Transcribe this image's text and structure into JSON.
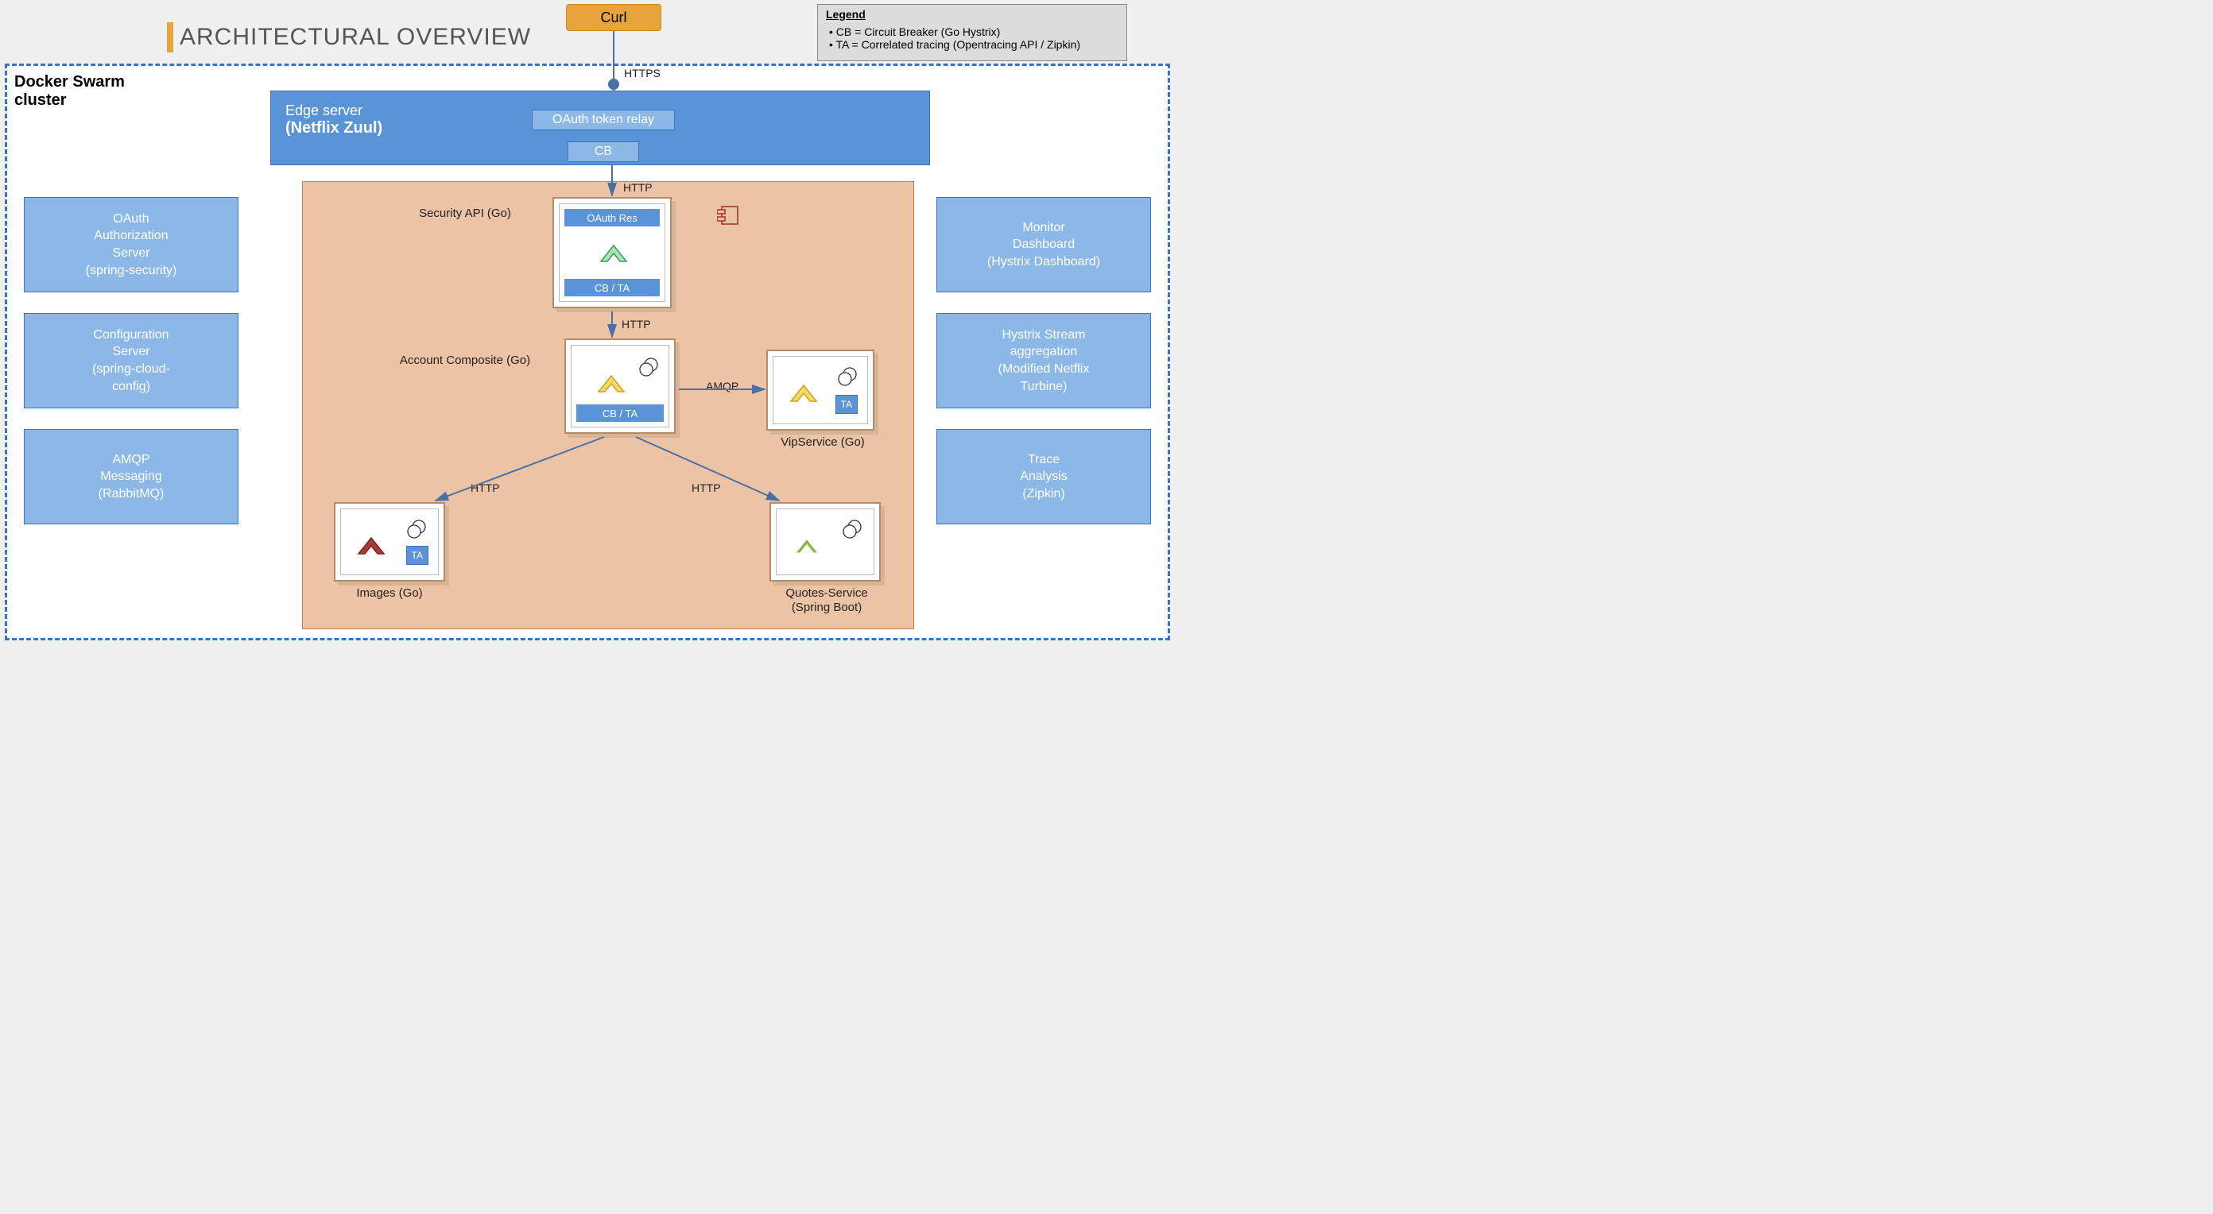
{
  "title": "ARCHITECTURAL OVERVIEW",
  "curl": "Curl",
  "legend": {
    "title": "Legend",
    "item1": "• CB = Circuit Breaker (Go Hystrix)",
    "item2": "• TA = Correlated tracing (Opentracing API / Zipkin)"
  },
  "cluster_label_l1": "Docker Swarm",
  "cluster_label_l2": "cluster",
  "edge": {
    "line1": "Edge server",
    "line2": "(Netflix Zuul)",
    "oauth_relay": "OAuth token relay",
    "cb": "CB"
  },
  "conns": {
    "https": "HTTPS",
    "http1": "HTTP",
    "http2": "HTTP",
    "http3": "HTTP",
    "http4": "HTTP",
    "amqp": "AMQP"
  },
  "left_panels": {
    "oauth_l1": "OAuth",
    "oauth_l2": "Authorization",
    "oauth_l3": "Server",
    "oauth_l4": "(spring-security)",
    "config_l1": "Configuration",
    "config_l2": "Server",
    "config_l3": "(spring-cloud-",
    "config_l4": "config)",
    "amqp_l1": "AMQP",
    "amqp_l2": "Messaging",
    "amqp_l3": "(RabbitMQ)"
  },
  "right_panels": {
    "monitor_l1": "Monitor",
    "monitor_l2": "Dashboard",
    "monitor_l3": "(Hystrix Dashboard)",
    "hystrix_l1": "Hystrix Stream",
    "hystrix_l2": "aggregation",
    "hystrix_l3": "(Modified Netflix",
    "hystrix_l4": "Turbine)",
    "trace_l1": "Trace",
    "trace_l2": "Analysis",
    "trace_l3": "(Zipkin)"
  },
  "services": {
    "security": {
      "label": "Security API (Go)",
      "header": "OAuth Res",
      "footer": "CB / TA"
    },
    "account": {
      "label": "Account Composite (Go)",
      "footer": "CB / TA"
    },
    "vip": {
      "label": "VipService (Go)",
      "ta": "TA"
    },
    "images": {
      "label": "Images (Go)",
      "ta": "TA"
    },
    "quotes": {
      "label_l1": "Quotes-Service",
      "label_l2": "(Spring Boot)"
    }
  }
}
